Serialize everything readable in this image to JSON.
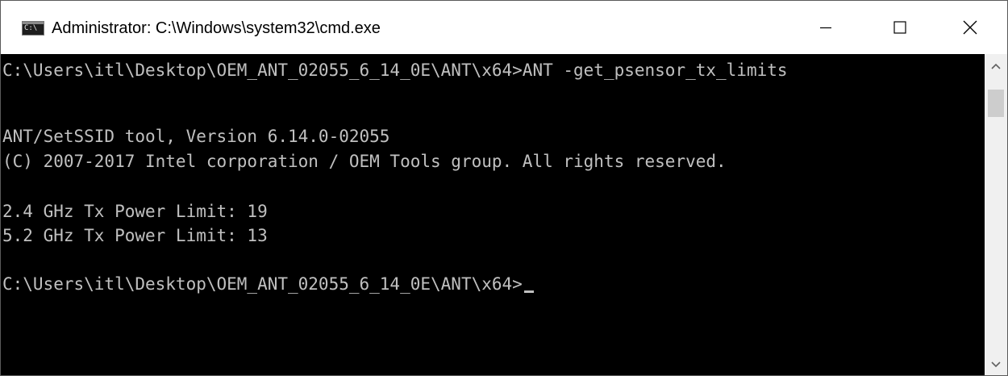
{
  "window": {
    "title": "Administrator: C:\\Windows\\system32\\cmd.exe",
    "icon_text": "C:\\",
    "icons": {
      "app": "cmd-icon",
      "minimize": "minimize-icon",
      "maximize": "maximize-icon",
      "close": "close-icon"
    }
  },
  "console": {
    "lines": [
      "C:\\Users\\itl\\Desktop\\OEM_ANT_02055_6_14_0E\\ANT\\x64>ANT -get_psensor_tx_limits",
      "",
      "ANT/SetSSID tool, Version 6.14.0-02055",
      "(C) 2007-2017 Intel corporation / OEM Tools group. All rights reserved.",
      "",
      "2.4 GHz Tx Power Limit: 19",
      "5.2 GHz Tx Power Limit: 13",
      "",
      "C:\\Users\\itl\\Desktop\\OEM_ANT_02055_6_14_0E\\ANT\\x64>"
    ],
    "colors": {
      "background": "#000000",
      "text": "#c0c0c0"
    }
  },
  "scrollbar": {
    "icons": {
      "up": "scroll-up-icon",
      "down": "scroll-down-icon"
    }
  }
}
